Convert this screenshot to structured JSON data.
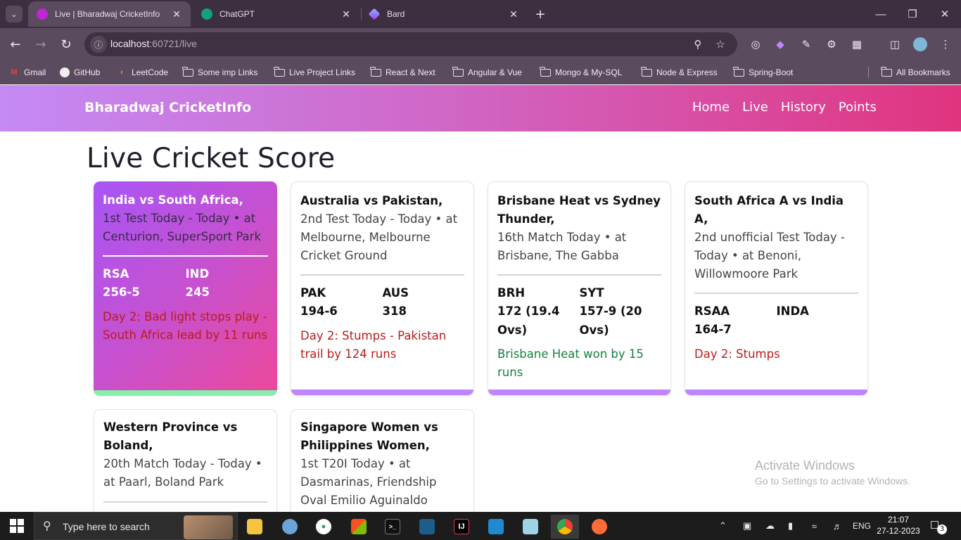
{
  "browser": {
    "tabs": [
      {
        "title": "Live | Bharadwaj CricketInfo",
        "active": true,
        "favicon_color": "#c026d3"
      },
      {
        "title": "ChatGPT",
        "active": false,
        "favicon_color": "#10a37f"
      },
      {
        "title": "Bard",
        "active": false,
        "favicon_color": "#8ab4f8"
      }
    ],
    "url_host": "localhost",
    "url_rest": ":60721/live",
    "bookmarks": [
      {
        "label": "Gmail",
        "icon": "gmail-icon"
      },
      {
        "label": "GitHub",
        "icon": "github-icon"
      },
      {
        "label": "LeetCode",
        "icon": "leetcode-icon"
      },
      {
        "label": "Some imp Links",
        "icon": "folder-icon"
      },
      {
        "label": "Live Project Links",
        "icon": "folder-icon"
      },
      {
        "label": "React & Next",
        "icon": "folder-icon"
      },
      {
        "label": "Angular & Vue",
        "icon": "folder-icon"
      },
      {
        "label": "Mongo & My-SQL",
        "icon": "folder-icon"
      },
      {
        "label": "Node & Express",
        "icon": "folder-icon"
      },
      {
        "label": "Spring-Boot",
        "icon": "folder-icon"
      }
    ],
    "all_bookmarks": "All Bookmarks"
  },
  "app": {
    "brand": "Bharadwaj CricketInfo",
    "nav": [
      "Home",
      "Live",
      "History",
      "Points"
    ],
    "page_title": "Live Cricket Score",
    "colors": {
      "gradient_start": "#c58af5",
      "gradient_end": "#e0347f",
      "live_status": "#b91c1c",
      "result_status": "#15803d"
    }
  },
  "matches": [
    {
      "title": "India vs South Africa,",
      "desc": "1st Test Today - Today • at Centurion, SuperSport Park",
      "team1": {
        "name": "RSA",
        "score": "256-5"
      },
      "team2": {
        "name": "IND",
        "score": "245"
      },
      "status": "Day 2: Bad light stops play - South Africa lead by 11 runs",
      "status_type": "live"
    },
    {
      "title": "Australia vs Pakistan,",
      "desc": "2nd Test Today - Today • at Melbourne, Melbourne Cricket Ground",
      "team1": {
        "name": "PAK",
        "score": "194-6"
      },
      "team2": {
        "name": "AUS",
        "score": "318"
      },
      "status": "Day 2: Stumps - Pakistan trail by 124 runs",
      "status_type": "live"
    },
    {
      "title": "Brisbane Heat vs Sydney Thunder,",
      "desc": "16th Match Today • at Brisbane, The Gabba",
      "team1": {
        "name": "BRH",
        "score": "172 (19.4 Ovs)"
      },
      "team2": {
        "name": "SYT",
        "score": "157-9 (20 Ovs)"
      },
      "status": "Brisbane Heat won by 15 runs",
      "status_type": "done"
    },
    {
      "title": "South Africa A vs India A,",
      "desc": "2nd unofficial Test Today - Today • at Benoni, Willowmoore Park",
      "team1": {
        "name": "RSAA",
        "score": "164-7"
      },
      "team2": {
        "name": "INDA",
        "score": ""
      },
      "status": "Day 2: Stumps",
      "status_type": "live"
    },
    {
      "title": "Western Province vs Boland,",
      "desc": "20th Match Today - Today • at Paarl, Boland Park"
    },
    {
      "title": "Singapore Women vs Philippines Women,",
      "desc": "1st T20I Today • at Dasmarinas, Friendship Oval Emilio Aguinaldo"
    }
  ],
  "watermark": {
    "line1": "Activate Windows",
    "line2": "Go to Settings to activate Windows."
  },
  "taskbar": {
    "search_placeholder": "Type here to search",
    "language": "ENG",
    "time": "21:07",
    "date": "27-12-2023",
    "notification_count": "3"
  }
}
